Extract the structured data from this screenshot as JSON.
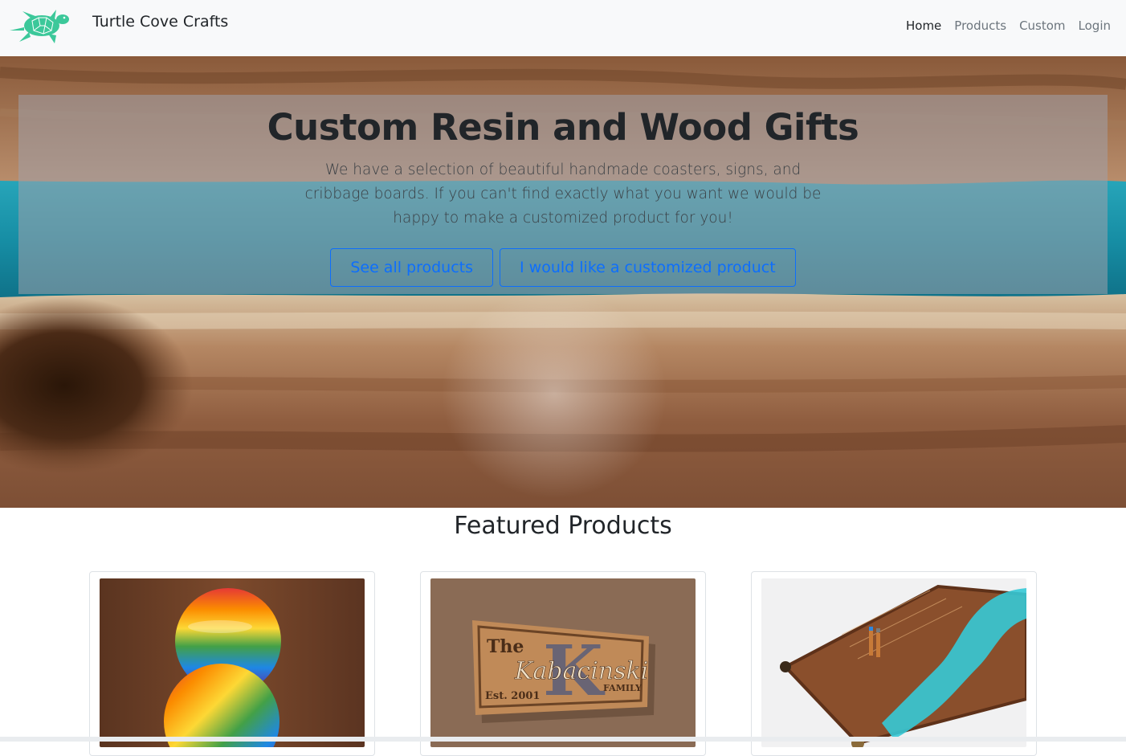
{
  "navbar": {
    "brand_name": "Turtle Cove Crafts",
    "logo_icon": "turtle-icon",
    "links": [
      {
        "label": "Home",
        "active": true
      },
      {
        "label": "Products",
        "active": false
      },
      {
        "label": "Custom",
        "active": false
      },
      {
        "label": "Login",
        "active": false
      }
    ]
  },
  "hero": {
    "title": "Custom Resin and Wood Gifts",
    "text": "We have a selection of beautiful handmade coasters, signs, and cribbage boards. If you can't find exactly what you want we would be happy to make a customized product for you!",
    "primary_button": "See all products",
    "secondary_button": "I would like a customized product"
  },
  "featured": {
    "title": "Featured Products",
    "products": [
      {
        "image": "rainbow-resin-coasters"
      },
      {
        "image": "family-name-wood-sign",
        "sign_words": [
          "The",
          "Kabacinski",
          "FAMILY",
          "Est. 2001",
          "K"
        ]
      },
      {
        "image": "resin-cribbage-board"
      }
    ]
  },
  "colors": {
    "primary": "#0d6efd",
    "navbar_bg": "#f8f9fa",
    "logo": "#3cc89a",
    "resin": "#1a93a8"
  }
}
